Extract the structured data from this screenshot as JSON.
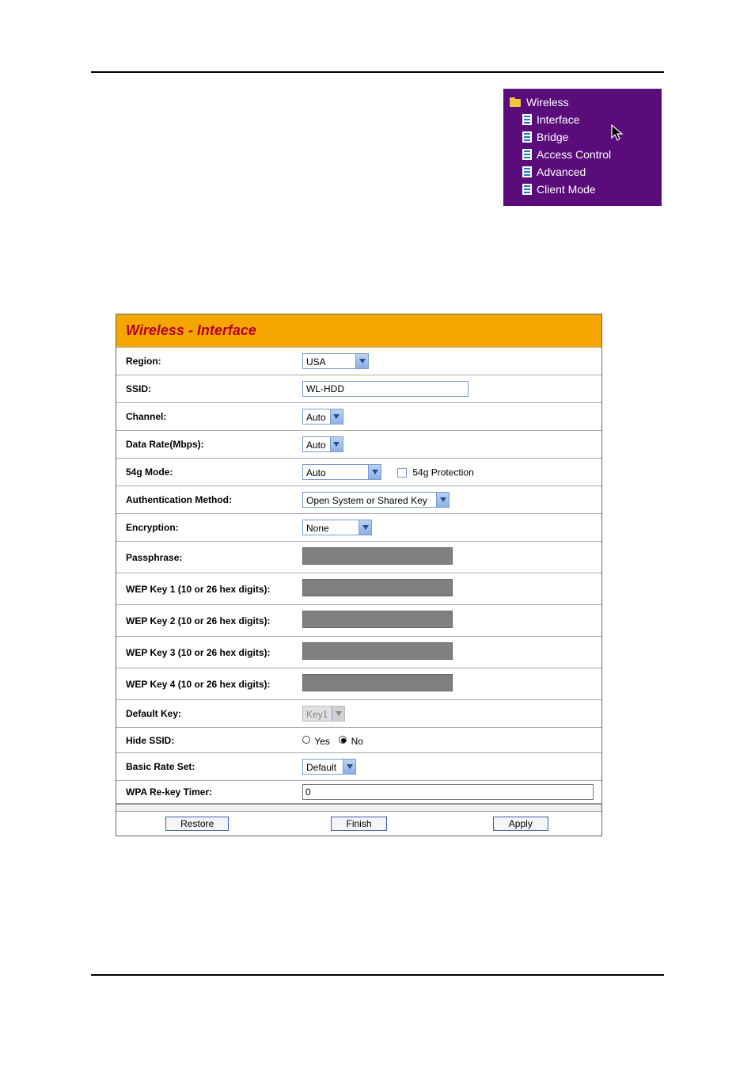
{
  "nav": {
    "root": "Wireless",
    "items": [
      "Interface",
      "Bridge",
      "Access Control",
      "Advanced",
      "Client Mode"
    ]
  },
  "panel": {
    "title": "Wireless - Interface",
    "fields": {
      "region_label": "Region:",
      "region_value": "USA",
      "ssid_label": "SSID:",
      "ssid_value": "WL-HDD",
      "channel_label": "Channel:",
      "channel_value": "Auto",
      "datarate_label": "Data Rate(Mbps):",
      "datarate_value": "Auto",
      "mode54g_label": "54g Mode:",
      "mode54g_value": "Auto",
      "protection_label": "54g Protection",
      "auth_label": "Authentication Method:",
      "auth_value": "Open System or Shared Key",
      "encryption_label": "Encryption:",
      "encryption_value": "None",
      "passphrase_label": "Passphrase:",
      "wep1_label": "WEP Key 1 (10 or 26 hex digits):",
      "wep2_label": "WEP Key 2 (10 or 26 hex digits):",
      "wep3_label": "WEP Key 3 (10 or 26 hex digits):",
      "wep4_label": "WEP Key 4 (10 or 26 hex digits):",
      "defaultkey_label": "Default Key:",
      "defaultkey_value": "Key1",
      "hidessid_label": "Hide SSID:",
      "hidessid_yes": "Yes",
      "hidessid_no": "No",
      "basicrate_label": "Basic Rate Set:",
      "basicrate_value": "Default",
      "wparekey_label": "WPA Re-key Timer:",
      "wparekey_value": "0"
    },
    "buttons": {
      "restore": "Restore",
      "finish": "Finish",
      "apply": "Apply"
    }
  }
}
